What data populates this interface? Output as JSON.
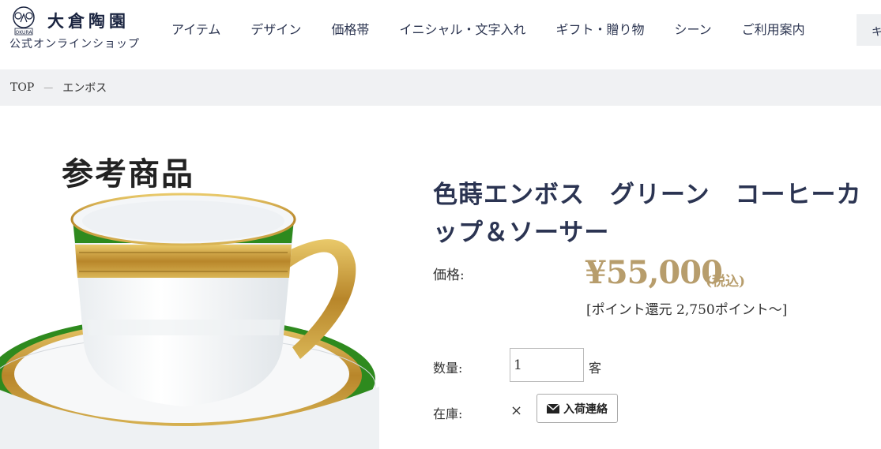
{
  "header": {
    "logo_name": "大倉陶園",
    "logo_sub": "公式オンラインショップ",
    "nav": [
      "アイテム",
      "デザイン",
      "価格帯",
      "イニシャル・文字入れ",
      "ギフト・贈り物",
      "シーン",
      "ご利用案内"
    ],
    "search_partial": "キ"
  },
  "breadcrumb": {
    "home": "TOP",
    "separator": "—",
    "current": "エンボス"
  },
  "product": {
    "image_label": "参考商品",
    "title": "色蒔エンボス　グリーン　コーヒーカップ＆ソーサー",
    "price_label": "価格:",
    "price": "¥55,000",
    "tax": "(税込)",
    "points": "[ポイント還元 2,750ポイント〜]",
    "quantity_label": "数量:",
    "quantity_value": "1",
    "quantity_unit": "客",
    "stock_label": "在庫:",
    "stock_status": "×",
    "notify_button": "入荷連絡"
  },
  "colors": {
    "accent_gold": "#b79d6c",
    "navy": "#2b3452",
    "cup_green": "#2e8a1e"
  }
}
